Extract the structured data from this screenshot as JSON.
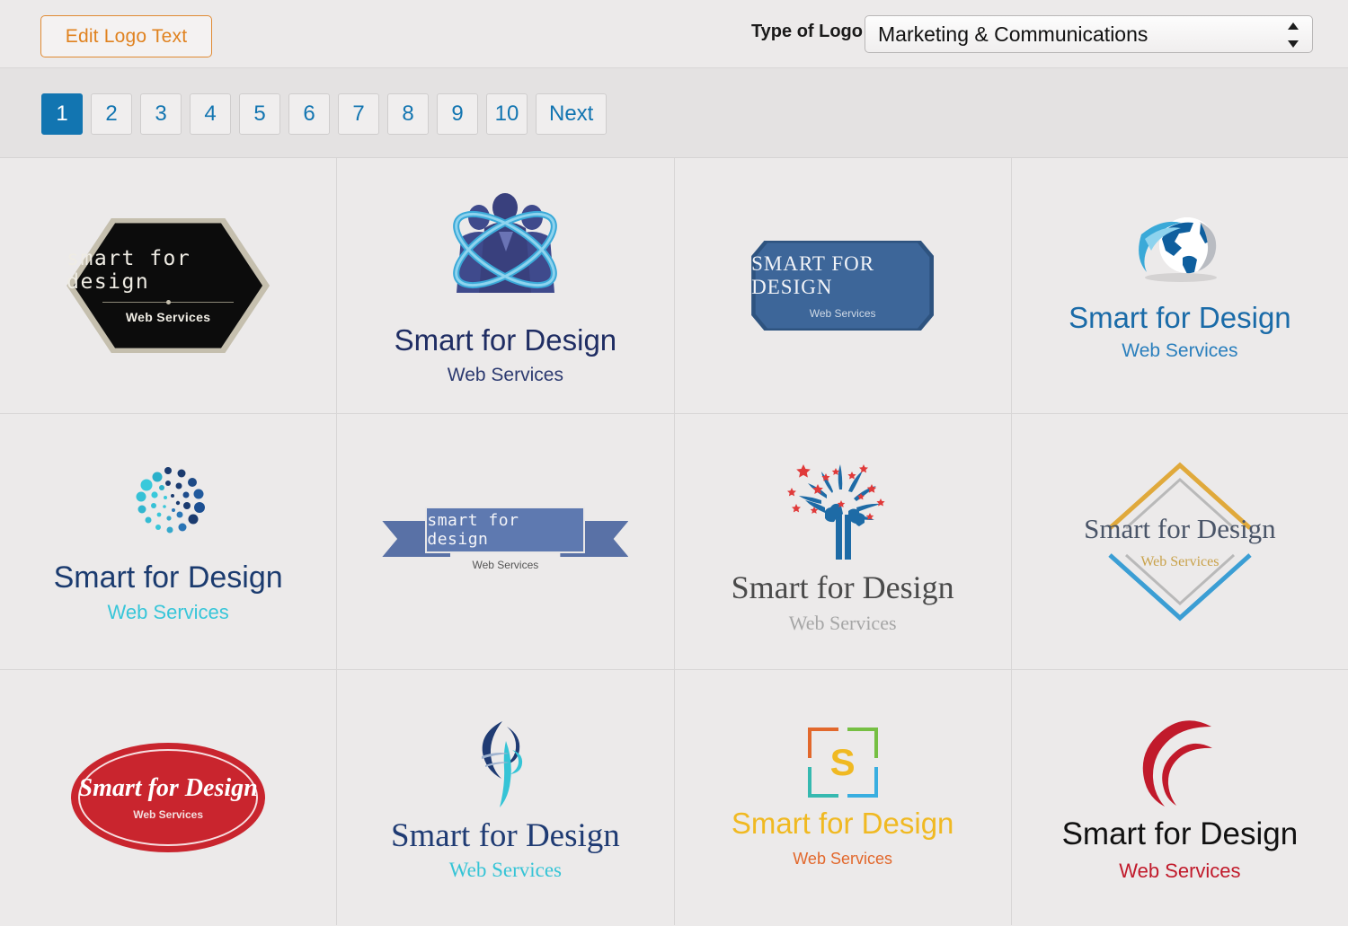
{
  "header": {
    "edit_button_label": "Edit Logo Text",
    "type_of_logo_label": "Type of Logo",
    "type_of_logo_value": "Marketing & Communications",
    "accent_orange": "#e0821f"
  },
  "pagination": {
    "pages": [
      "1",
      "2",
      "3",
      "4",
      "5",
      "6",
      "7",
      "8",
      "9",
      "10"
    ],
    "active": "1",
    "next_label": "Next",
    "active_color": "#1275b1"
  },
  "brand": {
    "name_mixed": "Smart for Design",
    "name_caps": "SMART FOR DESIGN",
    "name_lower": "smart for design",
    "tagline": "Web Services"
  },
  "logos": [
    {
      "id": 1,
      "style": "hexagon-badge",
      "name_text": "smart for design",
      "tagline": "Web Services",
      "primary_color": "#0c0c0c",
      "secondary_color": "#c5bfae"
    },
    {
      "id": 2,
      "style": "team-orbit",
      "name_text": "Smart for Design",
      "tagline": "Web Services",
      "primary_color": "#3f4a8c",
      "secondary_color": "#3aa9d8"
    },
    {
      "id": 3,
      "style": "blue-plaque",
      "name_text": "SMART FOR DESIGN",
      "tagline": "Web Services",
      "primary_color": "#3d6699",
      "secondary_color": "#2e537f"
    },
    {
      "id": 4,
      "style": "globe-swoosh",
      "name_text": "Smart for Design",
      "tagline": "Web Services",
      "primary_color": "#1a6ba8",
      "secondary_color": "#4ab8e8"
    },
    {
      "id": 5,
      "style": "dot-spiral",
      "name_text": "Smart for Design",
      "tagline": "Web Services",
      "primary_color": "#1b3b6f",
      "secondary_color": "#38c6d9"
    },
    {
      "id": 6,
      "style": "ribbon-banner",
      "name_text": "smart for design",
      "tagline": "Web Services",
      "primary_color": "#5e79b0",
      "secondary_color": "#5971a6"
    },
    {
      "id": 7,
      "style": "hand-tree-stars",
      "name_text": "Smart for Design",
      "tagline": "Web Services",
      "primary_color": "#1e6ba6",
      "secondary_color": "#e03a3a"
    },
    {
      "id": 8,
      "style": "chevron-diamond",
      "name_text": "Smart for Design",
      "tagline": "Web Services",
      "primary_color": "#e0a93b",
      "secondary_color": "#3b9ed4"
    },
    {
      "id": 9,
      "style": "red-oval",
      "name_text": "Smart for Design",
      "tagline": "Web Services",
      "primary_color": "#c9252e",
      "secondary_color": "#ffffff"
    },
    {
      "id": 10,
      "style": "calligraphy-mark",
      "name_text": "Smart for Design",
      "tagline": "Web Services",
      "primary_color": "#1f3b73",
      "secondary_color": "#35c4d6"
    },
    {
      "id": 11,
      "style": "corner-brackets",
      "name_text": "Smart for Design",
      "tagline": "Web Services",
      "primary_color": "#f0b922",
      "secondary_color": "#e2682c"
    },
    {
      "id": 12,
      "style": "red-crescents",
      "name_text": "Smart for Design",
      "tagline": "Web Services",
      "primary_color": "#c11a2b",
      "secondary_color": "#111111"
    }
  ]
}
